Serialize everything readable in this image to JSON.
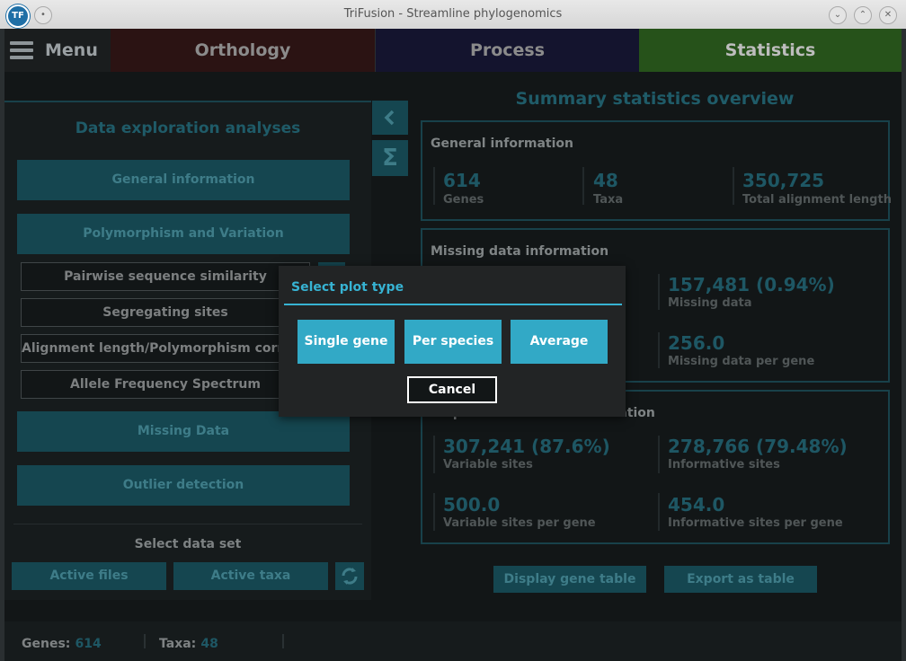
{
  "window": {
    "title": "TriFusion - Streamline phylogenomics",
    "logo_text": "TF"
  },
  "nav": {
    "menu_label": "Menu",
    "tabs": [
      "Orthology",
      "Process",
      "Statistics"
    ]
  },
  "sidebar": {
    "title": "Data exploration analyses",
    "sections": {
      "general": "General information",
      "polymorphism": "Polymorphism and Variation",
      "missing": "Missing Data",
      "outlier": "Outlier detection"
    },
    "sub_items": [
      "Pairwise sequence similarity",
      "Segregating sites",
      "Alignment length/Polymorphism correlation",
      "Allele Frequency Spectrum"
    ],
    "select_title": "Select data set",
    "active_files": "Active files",
    "active_taxa": "Active taxa"
  },
  "stats": {
    "title": "Summary statistics overview",
    "general": {
      "title": "General information",
      "genes_val": "614",
      "genes_lbl": "Genes",
      "taxa_val": "48",
      "taxa_lbl": "Taxa",
      "len_val": "350,725",
      "len_lbl": "Total alignment length"
    },
    "missing": {
      "title": "Missing data information",
      "md_val": "157,481 (0.94%)",
      "md_lbl": "Missing data",
      "mdg_val": "256.0",
      "mdg_lbl": "Missing data per gene"
    },
    "variation": {
      "title": "Sequence variation information",
      "var_val": "307,241 (87.6%)",
      "var_lbl": "Variable sites",
      "inf_val": "278,766 (79.48%)",
      "inf_lbl": "Informative sites",
      "vpg_val": "500.0",
      "vpg_lbl": "Variable sites per gene",
      "ipg_val": "454.0",
      "ipg_lbl": "Informative sites per gene"
    },
    "display_table": "Display gene table",
    "export_table": "Export as table"
  },
  "status": {
    "genes_lbl": "Genes:",
    "genes_val": "614",
    "taxa_lbl": "Taxa:",
    "taxa_val": "48"
  },
  "dialog": {
    "title": "Select plot type",
    "options": [
      "Single gene",
      "Per species",
      "Average"
    ],
    "cancel": "Cancel"
  },
  "colors": {
    "accent": "#37b3d3",
    "teal_dim": "#154650",
    "statistics_tab": "#26521a"
  }
}
